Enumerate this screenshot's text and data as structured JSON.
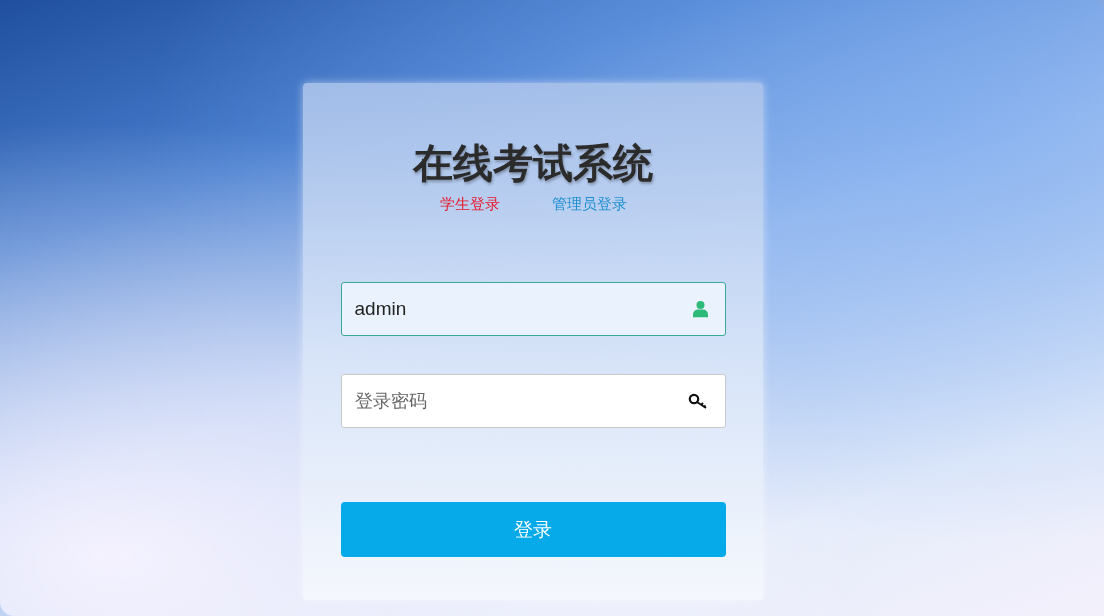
{
  "title": "在线考试系统",
  "login_links": [
    {
      "label": "学生登录",
      "color": "#e8192c"
    },
    {
      "label": "管理员登录",
      "color": "#1e8fd0"
    }
  ],
  "username": {
    "value": "admin",
    "focused": true
  },
  "password": {
    "placeholder": "登录密码",
    "focused": false
  },
  "submit_button": "登录"
}
